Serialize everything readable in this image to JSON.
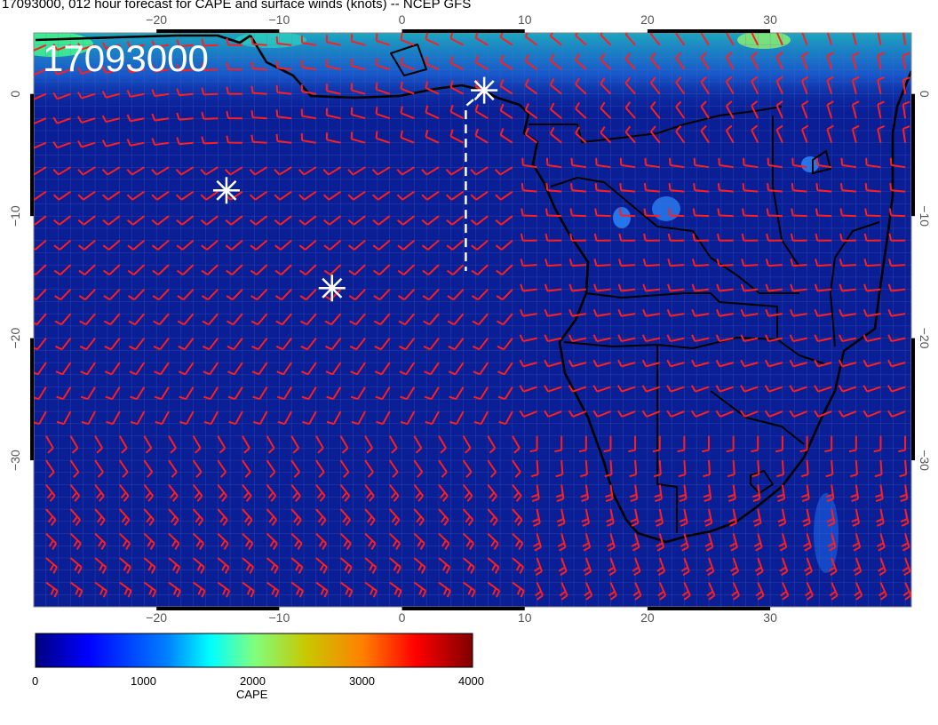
{
  "title": "17093000, 012 hour forecast for CAPE and surface winds (knots) -- NCEP GFS",
  "stamp": "17093000",
  "map": {
    "lon_range": [
      -30,
      41.5
    ],
    "lat_range": [
      -42,
      5
    ],
    "lon_ticks": [
      "−20",
      "−10",
      "0",
      "10",
      "20",
      "30"
    ],
    "lon_tick_values": [
      -20,
      -10,
      0,
      10,
      20,
      30
    ],
    "lat_ticks": [
      "0",
      "−10",
      "−20",
      "−30"
    ],
    "lat_tick_values": [
      0,
      -10,
      -20,
      -30
    ],
    "markers": [
      {
        "name": "asterisk",
        "lon": -14.3,
        "lat": -7.9
      },
      {
        "name": "asterisk",
        "lon": -5.7,
        "lat": -15.9
      },
      {
        "name": "asterisk",
        "lon": 6.7,
        "lat": 0.3
      }
    ],
    "flight_track": [
      [
        6.7,
        0.3
      ],
      [
        5.2,
        -1.0
      ],
      [
        5.2,
        -14.5
      ]
    ],
    "colors": {
      "background": "#0a1e96",
      "wind_barb": "#ff1e1e",
      "coastline": "#000000",
      "marker": "#ffffff"
    }
  },
  "colorbar": {
    "label": "CAPE",
    "ticks": [
      "0",
      "1000",
      "2000",
      "3000",
      "4000"
    ],
    "tick_values": [
      0,
      1000,
      2000,
      3000,
      4000
    ],
    "range": [
      0,
      4000
    ],
    "colors": [
      "#00007f",
      "#0000ff",
      "#007fff",
      "#00ffff",
      "#7fff7f",
      "#c8c800",
      "#ff7f00",
      "#ff0000",
      "#7f0000"
    ]
  }
}
